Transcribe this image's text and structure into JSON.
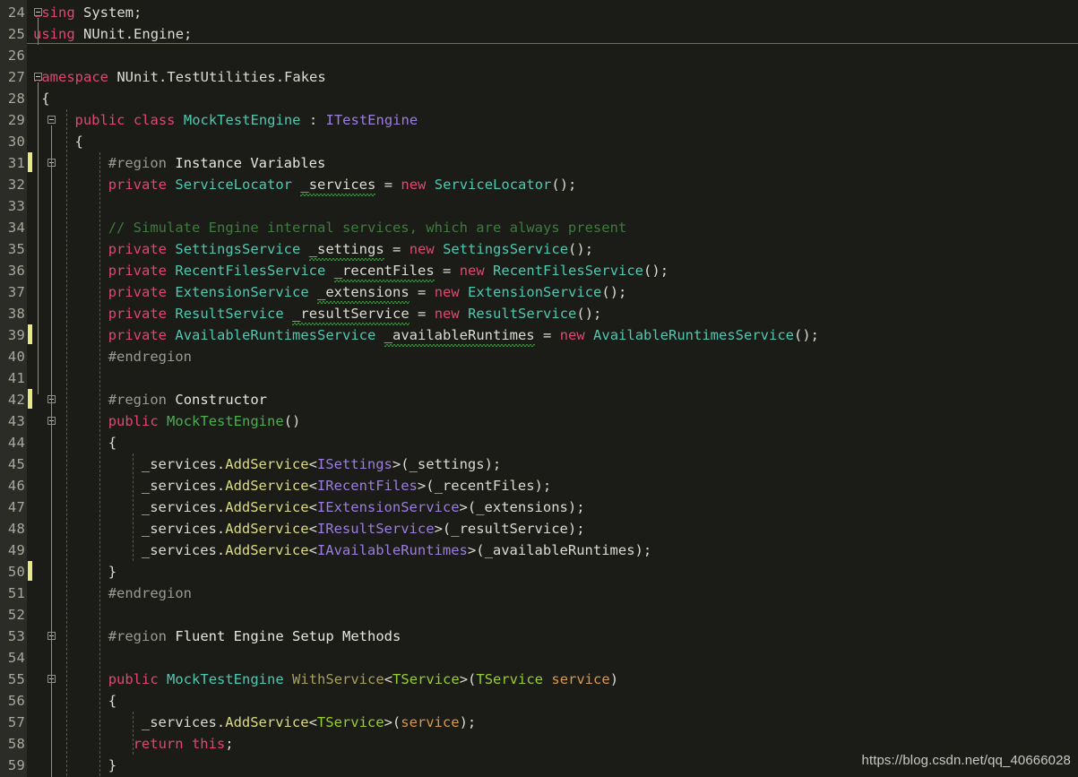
{
  "editor": {
    "language": "C#",
    "first_visible_line": 24,
    "last_visible_line": 59,
    "background_color": "#1b1b18",
    "gutter_color": "#2b2b27",
    "line_number_color": "#a8a89c",
    "change_bar_color": "#e8e884",
    "font_size_px": 15.5,
    "line_height_px": 24
  },
  "theme_colors": {
    "keyword": "#e0476f",
    "type": "#4ec9b0",
    "interface": "#9b7ede",
    "constructor": "#4caf50",
    "method": "#dcdc80",
    "method_declaration": "#a8a05a",
    "type_parameter": "#9acd32",
    "parameter": "#d69a52",
    "identifier": "#dcdcd2",
    "comment": "#3f7a3f",
    "preprocessor": "#9b9b92",
    "region_title": "#e6e6dc",
    "squiggle_warning": "#3f9a3f"
  },
  "watermark": {
    "text": "https://blog.csdn.net/qq_40666028"
  },
  "change_bar_lines": [
    31,
    39,
    42,
    50
  ],
  "fold_markers": [
    {
      "line": 24,
      "x": 38
    },
    {
      "line": 27,
      "x": 38
    },
    {
      "line": 29,
      "x": 53
    },
    {
      "line": 31,
      "x": 53
    },
    {
      "line": 42,
      "x": 53
    },
    {
      "line": 43,
      "x": 53
    },
    {
      "line": 53,
      "x": 53
    },
    {
      "line": 55,
      "x": 53
    }
  ],
  "lines": [
    {
      "n": 24,
      "text": "using System;",
      "tokens": [
        {
          "t": "using",
          "c": "kw"
        },
        {
          "t": " ",
          "c": "plain"
        },
        {
          "t": "System",
          "c": "plain"
        },
        {
          "t": ";",
          "c": "punct"
        }
      ]
    },
    {
      "n": 25,
      "text": "using NUnit.Engine;",
      "tokens": [
        {
          "t": "using",
          "c": "kw"
        },
        {
          "t": " ",
          "c": "plain"
        },
        {
          "t": "NUnit",
          "c": "plain"
        },
        {
          "t": ".",
          "c": "punct"
        },
        {
          "t": "Engine",
          "c": "plain"
        },
        {
          "t": ";",
          "c": "punct"
        }
      ]
    },
    {
      "n": 26,
      "text": "",
      "tokens": []
    },
    {
      "n": 27,
      "text": "namespace NUnit.TestUtilities.Fakes",
      "tokens": [
        {
          "t": "namespace",
          "c": "kw"
        },
        {
          "t": " ",
          "c": "plain"
        },
        {
          "t": "NUnit",
          "c": "plain"
        },
        {
          "t": ".",
          "c": "punct"
        },
        {
          "t": "TestUtilities",
          "c": "plain"
        },
        {
          "t": ".",
          "c": "punct"
        },
        {
          "t": "Fakes",
          "c": "plain"
        }
      ]
    },
    {
      "n": 28,
      "text": "{",
      "indent": 1,
      "tokens": [
        {
          "t": "{",
          "c": "punct"
        }
      ]
    },
    {
      "n": 29,
      "text": "    public class MockTestEngine : ITestEngine",
      "indent": 5,
      "tokens": [
        {
          "t": "public",
          "c": "kw"
        },
        {
          "t": " ",
          "c": "plain"
        },
        {
          "t": "class",
          "c": "kw"
        },
        {
          "t": " ",
          "c": "plain"
        },
        {
          "t": "MockTestEngine",
          "c": "type"
        },
        {
          "t": " : ",
          "c": "punct"
        },
        {
          "t": "ITestEngine",
          "c": "iface"
        }
      ]
    },
    {
      "n": 30,
      "text": "    {",
      "indent": 5,
      "tokens": [
        {
          "t": "{",
          "c": "punct"
        }
      ]
    },
    {
      "n": 31,
      "text": "        #region Instance Variables",
      "indent": 9,
      "tokens": [
        {
          "t": "#region",
          "c": "pp"
        },
        {
          "t": " ",
          "c": "plain"
        },
        {
          "t": "Instance Variables",
          "c": "ppname"
        }
      ]
    },
    {
      "n": 32,
      "text": "        private ServiceLocator _services = new ServiceLocator();",
      "indent": 9,
      "tokens": [
        {
          "t": "private",
          "c": "kw"
        },
        {
          "t": " ",
          "c": "plain"
        },
        {
          "t": "ServiceLocator",
          "c": "type"
        },
        {
          "t": " ",
          "c": "plain"
        },
        {
          "t": "_services",
          "c": "field",
          "squiggle": true
        },
        {
          "t": " ",
          "c": "plain"
        },
        {
          "t": "=",
          "c": "punct"
        },
        {
          "t": " ",
          "c": "plain"
        },
        {
          "t": "new",
          "c": "kw"
        },
        {
          "t": " ",
          "c": "plain"
        },
        {
          "t": "ServiceLocator",
          "c": "type"
        },
        {
          "t": "();",
          "c": "punct"
        }
      ]
    },
    {
      "n": 33,
      "text": "",
      "tokens": []
    },
    {
      "n": 34,
      "text": "        // Simulate Engine internal services, which are always present",
      "indent": 9,
      "tokens": [
        {
          "t": "// Simulate Engine internal services, which are always present",
          "c": "cmt"
        }
      ]
    },
    {
      "n": 35,
      "text": "        private SettingsService _settings = new SettingsService();",
      "indent": 9,
      "tokens": [
        {
          "t": "private",
          "c": "kw"
        },
        {
          "t": " ",
          "c": "plain"
        },
        {
          "t": "SettingsService",
          "c": "type"
        },
        {
          "t": " ",
          "c": "plain"
        },
        {
          "t": "_settings",
          "c": "field",
          "squiggle": true
        },
        {
          "t": " ",
          "c": "plain"
        },
        {
          "t": "=",
          "c": "punct"
        },
        {
          "t": " ",
          "c": "plain"
        },
        {
          "t": "new",
          "c": "kw"
        },
        {
          "t": " ",
          "c": "plain"
        },
        {
          "t": "SettingsService",
          "c": "type"
        },
        {
          "t": "();",
          "c": "punct"
        }
      ]
    },
    {
      "n": 36,
      "text": "        private RecentFilesService _recentFiles = new RecentFilesService();",
      "indent": 9,
      "tokens": [
        {
          "t": "private",
          "c": "kw"
        },
        {
          "t": " ",
          "c": "plain"
        },
        {
          "t": "RecentFilesService",
          "c": "type"
        },
        {
          "t": " ",
          "c": "plain"
        },
        {
          "t": "_recentFiles",
          "c": "field",
          "squiggle": true
        },
        {
          "t": " ",
          "c": "plain"
        },
        {
          "t": "=",
          "c": "punct"
        },
        {
          "t": " ",
          "c": "plain"
        },
        {
          "t": "new",
          "c": "kw"
        },
        {
          "t": " ",
          "c": "plain"
        },
        {
          "t": "RecentFilesService",
          "c": "type"
        },
        {
          "t": "();",
          "c": "punct"
        }
      ]
    },
    {
      "n": 37,
      "text": "        private ExtensionService _extensions = new ExtensionService();",
      "indent": 9,
      "tokens": [
        {
          "t": "private",
          "c": "kw"
        },
        {
          "t": " ",
          "c": "plain"
        },
        {
          "t": "ExtensionService",
          "c": "type"
        },
        {
          "t": " ",
          "c": "plain"
        },
        {
          "t": "_extensions",
          "c": "field",
          "squiggle": true
        },
        {
          "t": " ",
          "c": "plain"
        },
        {
          "t": "=",
          "c": "punct"
        },
        {
          "t": " ",
          "c": "plain"
        },
        {
          "t": "new",
          "c": "kw"
        },
        {
          "t": " ",
          "c": "plain"
        },
        {
          "t": "ExtensionService",
          "c": "type"
        },
        {
          "t": "();",
          "c": "punct"
        }
      ]
    },
    {
      "n": 38,
      "text": "        private ResultService _resultService = new ResultService();",
      "indent": 9,
      "tokens": [
        {
          "t": "private",
          "c": "kw"
        },
        {
          "t": " ",
          "c": "plain"
        },
        {
          "t": "ResultService",
          "c": "type"
        },
        {
          "t": " ",
          "c": "plain"
        },
        {
          "t": "_resultService",
          "c": "field",
          "squiggle": true
        },
        {
          "t": " ",
          "c": "plain"
        },
        {
          "t": "=",
          "c": "punct"
        },
        {
          "t": " ",
          "c": "plain"
        },
        {
          "t": "new",
          "c": "kw"
        },
        {
          "t": " ",
          "c": "plain"
        },
        {
          "t": "ResultService",
          "c": "type"
        },
        {
          "t": "();",
          "c": "punct"
        }
      ]
    },
    {
      "n": 39,
      "text": "        private AvailableRuntimesService _availableRuntimes = new AvailableRuntimesService();",
      "indent": 9,
      "tokens": [
        {
          "t": "private",
          "c": "kw"
        },
        {
          "t": " ",
          "c": "plain"
        },
        {
          "t": "AvailableRuntimesService",
          "c": "type"
        },
        {
          "t": " ",
          "c": "plain"
        },
        {
          "t": "_availableRuntimes",
          "c": "field",
          "squiggle": true
        },
        {
          "t": " ",
          "c": "plain"
        },
        {
          "t": "=",
          "c": "punct"
        },
        {
          "t": " ",
          "c": "plain"
        },
        {
          "t": "new",
          "c": "kw"
        },
        {
          "t": " ",
          "c": "plain"
        },
        {
          "t": "AvailableRuntimesService",
          "c": "type"
        },
        {
          "t": "();",
          "c": "punct"
        }
      ]
    },
    {
      "n": 40,
      "text": "        #endregion",
      "indent": 9,
      "tokens": [
        {
          "t": "#endregion",
          "c": "pp"
        }
      ]
    },
    {
      "n": 41,
      "text": "",
      "tokens": []
    },
    {
      "n": 42,
      "text": "        #region Constructor",
      "indent": 9,
      "tokens": [
        {
          "t": "#region",
          "c": "pp"
        },
        {
          "t": " ",
          "c": "plain"
        },
        {
          "t": "Constructor",
          "c": "ppname"
        }
      ]
    },
    {
      "n": 43,
      "text": "        public MockTestEngine()",
      "indent": 9,
      "tokens": [
        {
          "t": "public",
          "c": "kw"
        },
        {
          "t": " ",
          "c": "plain"
        },
        {
          "t": "MockTestEngine",
          "c": "ctor"
        },
        {
          "t": "()",
          "c": "punct"
        }
      ]
    },
    {
      "n": 44,
      "text": "        {",
      "indent": 9,
      "tokens": [
        {
          "t": "{",
          "c": "punct"
        }
      ]
    },
    {
      "n": 45,
      "text": "            _services.AddService<ISettings>(_settings);",
      "indent": 13,
      "tokens": [
        {
          "t": "_services",
          "c": "field"
        },
        {
          "t": ".",
          "c": "punct"
        },
        {
          "t": "AddService",
          "c": "method"
        },
        {
          "t": "<",
          "c": "punct"
        },
        {
          "t": "ISettings",
          "c": "iface"
        },
        {
          "t": ">(",
          "c": "punct"
        },
        {
          "t": "_settings",
          "c": "field"
        },
        {
          "t": ");",
          "c": "punct"
        }
      ]
    },
    {
      "n": 46,
      "text": "            _services.AddService<IRecentFiles>(_recentFiles);",
      "indent": 13,
      "tokens": [
        {
          "t": "_services",
          "c": "field"
        },
        {
          "t": ".",
          "c": "punct"
        },
        {
          "t": "AddService",
          "c": "method"
        },
        {
          "t": "<",
          "c": "punct"
        },
        {
          "t": "IRecentFiles",
          "c": "iface"
        },
        {
          "t": ">(",
          "c": "punct"
        },
        {
          "t": "_recentFiles",
          "c": "field"
        },
        {
          "t": ");",
          "c": "punct"
        }
      ]
    },
    {
      "n": 47,
      "text": "            _services.AddService<IExtensionService>(_extensions);",
      "indent": 13,
      "tokens": [
        {
          "t": "_services",
          "c": "field"
        },
        {
          "t": ".",
          "c": "punct"
        },
        {
          "t": "AddService",
          "c": "method"
        },
        {
          "t": "<",
          "c": "punct"
        },
        {
          "t": "IExtensionService",
          "c": "iface"
        },
        {
          "t": ">(",
          "c": "punct"
        },
        {
          "t": "_extensions",
          "c": "field"
        },
        {
          "t": ");",
          "c": "punct"
        }
      ]
    },
    {
      "n": 48,
      "text": "            _services.AddService<IResultService>(_resultService);",
      "indent": 13,
      "tokens": [
        {
          "t": "_services",
          "c": "field"
        },
        {
          "t": ".",
          "c": "punct"
        },
        {
          "t": "AddService",
          "c": "method"
        },
        {
          "t": "<",
          "c": "punct"
        },
        {
          "t": "IResultService",
          "c": "iface"
        },
        {
          "t": ">(",
          "c": "punct"
        },
        {
          "t": "_resultService",
          "c": "field"
        },
        {
          "t": ");",
          "c": "punct"
        }
      ]
    },
    {
      "n": 49,
      "text": "            _services.AddService<IAvailableRuntimes>(_availableRuntimes);",
      "indent": 13,
      "tokens": [
        {
          "t": "_services",
          "c": "field"
        },
        {
          "t": ".",
          "c": "punct"
        },
        {
          "t": "AddService",
          "c": "method"
        },
        {
          "t": "<",
          "c": "punct"
        },
        {
          "t": "IAvailableRuntimes",
          "c": "iface"
        },
        {
          "t": ">(",
          "c": "punct"
        },
        {
          "t": "_availableRuntimes",
          "c": "field"
        },
        {
          "t": ");",
          "c": "punct"
        }
      ]
    },
    {
      "n": 50,
      "text": "        }",
      "indent": 9,
      "tokens": [
        {
          "t": "}",
          "c": "punct"
        }
      ]
    },
    {
      "n": 51,
      "text": "        #endregion",
      "indent": 9,
      "tokens": [
        {
          "t": "#endregion",
          "c": "pp"
        }
      ]
    },
    {
      "n": 52,
      "text": "",
      "tokens": []
    },
    {
      "n": 53,
      "text": "        #region Fluent Engine Setup Methods",
      "indent": 9,
      "tokens": [
        {
          "t": "#region",
          "c": "pp"
        },
        {
          "t": " ",
          "c": "plain"
        },
        {
          "t": "Fluent Engine Setup Methods",
          "c": "ppname"
        }
      ]
    },
    {
      "n": 54,
      "text": "",
      "tokens": []
    },
    {
      "n": 55,
      "text": "        public MockTestEngine WithService<TService>(TService service)",
      "indent": 9,
      "tokens": [
        {
          "t": "public",
          "c": "kw"
        },
        {
          "t": " ",
          "c": "plain"
        },
        {
          "t": "MockTestEngine",
          "c": "type"
        },
        {
          "t": " ",
          "c": "plain"
        },
        {
          "t": "WithService",
          "c": "methodd"
        },
        {
          "t": "<",
          "c": "punct"
        },
        {
          "t": "TService",
          "c": "tparam"
        },
        {
          "t": ">(",
          "c": "punct"
        },
        {
          "t": "TService",
          "c": "tparam"
        },
        {
          "t": " ",
          "c": "plain"
        },
        {
          "t": "service",
          "c": "param"
        },
        {
          "t": ")",
          "c": "punct"
        }
      ]
    },
    {
      "n": 56,
      "text": "        {",
      "indent": 9,
      "tokens": [
        {
          "t": "{",
          "c": "punct"
        }
      ]
    },
    {
      "n": 57,
      "text": "            _services.AddService<TService>(service);",
      "indent": 13,
      "tokens": [
        {
          "t": "_services",
          "c": "field"
        },
        {
          "t": ".",
          "c": "punct"
        },
        {
          "t": "AddService",
          "c": "method"
        },
        {
          "t": "<",
          "c": "punct"
        },
        {
          "t": "TService",
          "c": "tparam"
        },
        {
          "t": ">(",
          "c": "punct"
        },
        {
          "t": "service",
          "c": "param"
        },
        {
          "t": ");",
          "c": "punct"
        }
      ]
    },
    {
      "n": 58,
      "text": "            return this;",
      "indent": 12,
      "tokens": [
        {
          "t": "return",
          "c": "kw"
        },
        {
          "t": " ",
          "c": "plain"
        },
        {
          "t": "this",
          "c": "kw"
        },
        {
          "t": ";",
          "c": "punct"
        }
      ]
    },
    {
      "n": 59,
      "text": "        }",
      "indent": 9,
      "tokens": [
        {
          "t": "}",
          "c": "punct"
        }
      ]
    }
  ]
}
